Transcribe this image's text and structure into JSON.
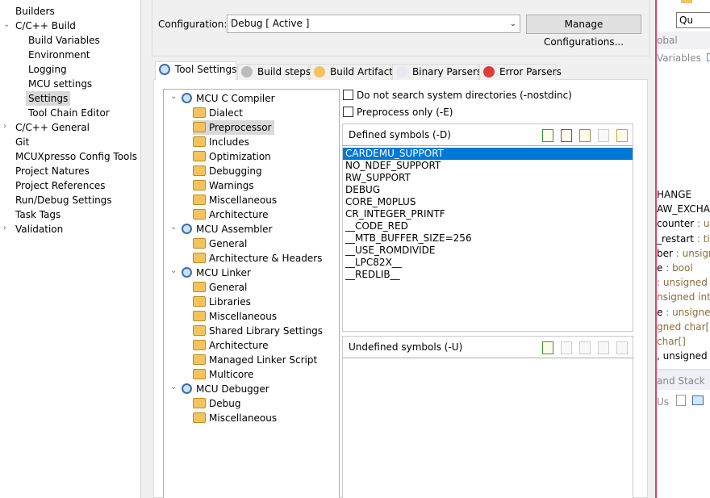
{
  "sidebar": {
    "items": [
      {
        "label": "Builders",
        "level": 0
      },
      {
        "label": "C/C++ Build",
        "level": 0,
        "expanded": true
      },
      {
        "label": "Build Variables",
        "level": 1
      },
      {
        "label": "Environment",
        "level": 1
      },
      {
        "label": "Logging",
        "level": 1
      },
      {
        "label": "MCU settings",
        "level": 1
      },
      {
        "label": "Settings",
        "level": 1,
        "selected": true
      },
      {
        "label": "Tool Chain Editor",
        "level": 1
      },
      {
        "label": "C/C++ General",
        "level": 0,
        "expanded": false
      },
      {
        "label": "Git",
        "level": 0
      },
      {
        "label": "MCUXpresso Config Tools",
        "level": 0
      },
      {
        "label": "Project Natures",
        "level": 0
      },
      {
        "label": "Project References",
        "level": 0
      },
      {
        "label": "Run/Debug Settings",
        "level": 0
      },
      {
        "label": "Task Tags",
        "level": 0
      },
      {
        "label": "Validation",
        "level": 0,
        "expanded": false
      }
    ]
  },
  "configuration": {
    "label": "Configuration:",
    "value": "Debug  [ Active ]",
    "manage_label": "Manage Configurations..."
  },
  "tabs": [
    {
      "label": "Tool Settings",
      "icon": "gear-icon",
      "active": true
    },
    {
      "label": "Build steps",
      "icon": "build-steps-icon"
    },
    {
      "label": "Build Artifact",
      "icon": "trophy-icon"
    },
    {
      "label": "Binary Parsers",
      "icon": "binary-icon"
    },
    {
      "label": "Error Parsers",
      "icon": "error-icon"
    }
  ],
  "tree": [
    {
      "label": "MCU C Compiler",
      "level": 0
    },
    {
      "label": "Dialect",
      "level": 1
    },
    {
      "label": "Preprocessor",
      "level": 1,
      "selected": true
    },
    {
      "label": "Includes",
      "level": 1
    },
    {
      "label": "Optimization",
      "level": 1
    },
    {
      "label": "Debugging",
      "level": 1
    },
    {
      "label": "Warnings",
      "level": 1
    },
    {
      "label": "Miscellaneous",
      "level": 1
    },
    {
      "label": "Architecture",
      "level": 1
    },
    {
      "label": "MCU Assembler",
      "level": 0
    },
    {
      "label": "General",
      "level": 1
    },
    {
      "label": "Architecture & Headers",
      "level": 1
    },
    {
      "label": "MCU Linker",
      "level": 0
    },
    {
      "label": "General",
      "level": 1
    },
    {
      "label": "Libraries",
      "level": 1
    },
    {
      "label": "Miscellaneous",
      "level": 1
    },
    {
      "label": "Shared Library Settings",
      "level": 1
    },
    {
      "label": "Architecture",
      "level": 1
    },
    {
      "label": "Managed Linker Script",
      "level": 1
    },
    {
      "label": "Multicore",
      "level": 1
    },
    {
      "label": "MCU Debugger",
      "level": 0
    },
    {
      "label": "Debug",
      "level": 1
    },
    {
      "label": "Miscellaneous",
      "level": 1
    }
  ],
  "options": {
    "nostdinc": "Do not search system directories (-nostdinc)",
    "nostdinc_checked": false,
    "preprocess_only": "Preprocess only (-E)",
    "preprocess_only_checked": false
  },
  "defined": {
    "title": "Defined symbols (-D)",
    "symbols": [
      "CARDEMU_SUPPORT",
      "NO_NDEF_SUPPORT",
      "RW_SUPPORT",
      "DEBUG",
      "CORE_M0PLUS",
      "CR_INTEGER_PRINTF",
      "__CODE_RED",
      "__MTB_BUFFER_SIZE=256",
      "__USE_ROMDIVIDE",
      "__LPC82X__",
      "__REDLIB__"
    ],
    "selected": 0
  },
  "undefined": {
    "title": "Undefined symbols (-U)",
    "symbols": []
  },
  "right_panel": {
    "search": "Qu",
    "tab": "obal Variables",
    "lines": [
      {
        "name": "HANGE",
        "type": ""
      },
      {
        "name": "AW_EXCHANG",
        "type": ""
      },
      {
        "name": "counter",
        "type": " : unsig"
      },
      {
        "name": "_restart",
        "type": " : time"
      },
      {
        "name": "ber",
        "type": " : unsigned"
      },
      {
        "name": "e",
        "type": " : bool"
      },
      {
        "name": "",
        "type": ": unsigned int"
      },
      {
        "name": "",
        "type": "nsigned int"
      },
      {
        "name": "e",
        "type": " : unsigned i"
      },
      {
        "name": "",
        "type": "gned char[]"
      },
      {
        "name": "",
        "type": "char[]"
      },
      {
        "name": ", unsigned ch",
        "type": ""
      }
    ],
    "bottom_tab": "and Stack Us"
  }
}
